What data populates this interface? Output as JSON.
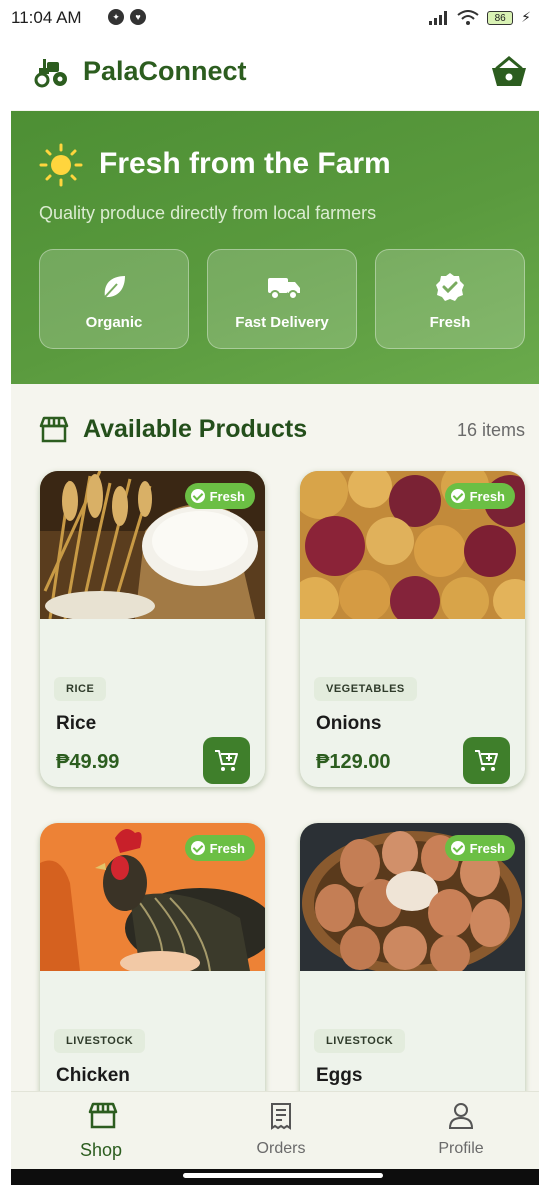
{
  "status_bar": {
    "time": "11:04 AM",
    "battery": "86"
  },
  "app_bar": {
    "title": "PalaConnect"
  },
  "hero": {
    "title": "Fresh from the Farm",
    "subtitle": "Quality produce directly from local farmers",
    "features": [
      {
        "label": "Organic",
        "icon": "leaf-icon"
      },
      {
        "label": "Fast Delivery",
        "icon": "truck-icon"
      },
      {
        "label": "Fresh",
        "icon": "verified-badge-icon"
      }
    ]
  },
  "products_section": {
    "title": "Available Products",
    "count": "16 items"
  },
  "products": [
    {
      "badge": "Fresh",
      "category": "RICE",
      "name": "Rice",
      "price": "₱49.99"
    },
    {
      "badge": "Fresh",
      "category": "VEGETABLES",
      "name": "Onions",
      "price": "₱129.00"
    },
    {
      "badge": "Fresh",
      "category": "LIVESTOCK",
      "name": "Chicken",
      "price": ""
    },
    {
      "badge": "Fresh",
      "category": "LIVESTOCK",
      "name": "Eggs",
      "price": ""
    }
  ],
  "bottom_nav": {
    "items": [
      {
        "label": "Shop",
        "icon": "storefront-icon",
        "active": true
      },
      {
        "label": "Orders",
        "icon": "receipt-icon",
        "active": false
      },
      {
        "label": "Profile",
        "icon": "person-icon",
        "active": false
      }
    ]
  },
  "colors": {
    "brand_green": "#2c5d1f",
    "hero_green": "#5a9a3e",
    "badge_green": "#6bbf44",
    "cart_button": "#3f7f2b"
  }
}
